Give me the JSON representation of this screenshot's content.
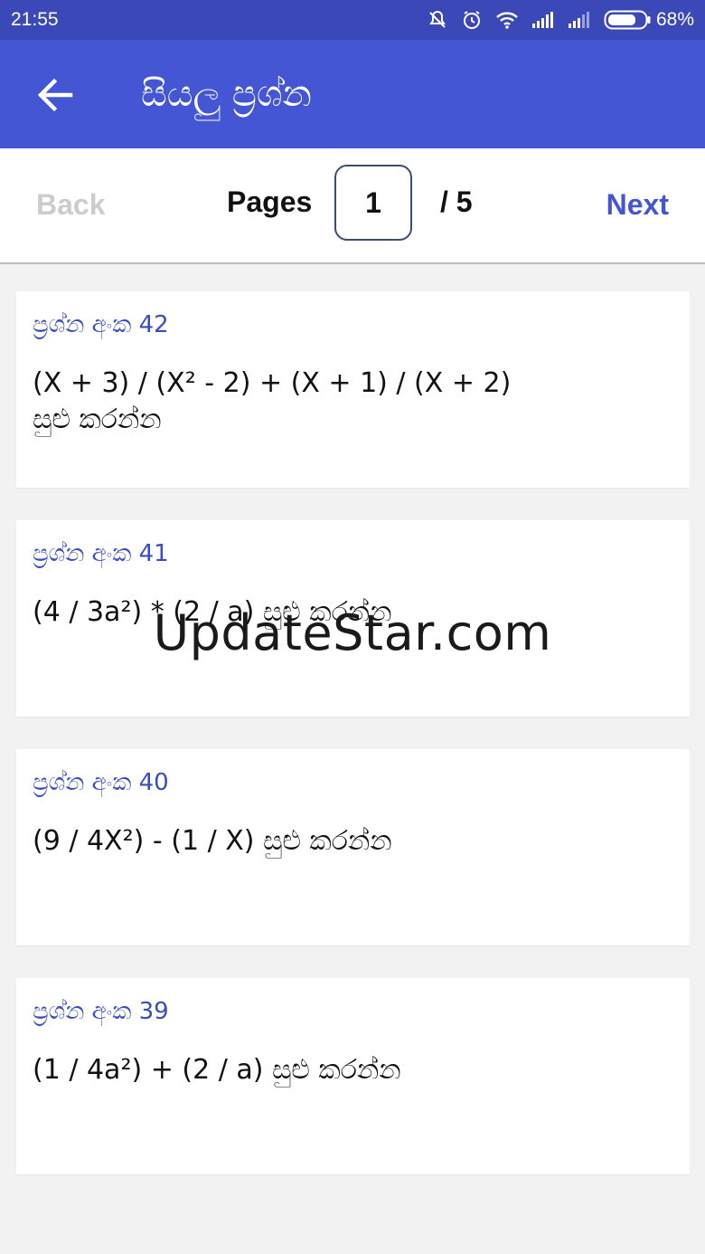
{
  "status_bar": {
    "time": "21:55",
    "battery_percent": "68%",
    "icons": [
      "mute-icon",
      "alarm-icon",
      "wifi-icon",
      "signal-icon",
      "signal-icon",
      "battery-icon"
    ]
  },
  "app_bar": {
    "back_icon": "arrow-left-icon",
    "title": "සියලු ප්‍රශ්න"
  },
  "pager": {
    "back_label": "Back",
    "pages_label": "Pages",
    "current_page": "1",
    "total_label": "/ 5",
    "next_label": "Next"
  },
  "questions": [
    {
      "number_label": "ප්‍රශ්න අංක 42",
      "text": "(X + 3) / (X² - 2)   +   (X + 1) / (X + 2)\n සුළු කරන්න"
    },
    {
      "number_label": "ප්‍රශ්න අංක 41",
      "text": "(4 / 3a²) * (2 / a)   සුළු කරන්න"
    },
    {
      "number_label": "ප්‍රශ්න අංක 40",
      "text": "(9 / 4X²) - (1 / X)   සුළු කරන්න"
    },
    {
      "number_label": "ප්‍රශ්න අංක 39",
      "text": "(1 / 4a²) + (2 / a)   සුළු කරන්න"
    }
  ],
  "watermark": "UpdateStar.com",
  "colors": {
    "app_bar": "#4456d3",
    "status_bar": "#3a48b8",
    "accent": "#4456d3",
    "disabled": "#cccccc"
  }
}
